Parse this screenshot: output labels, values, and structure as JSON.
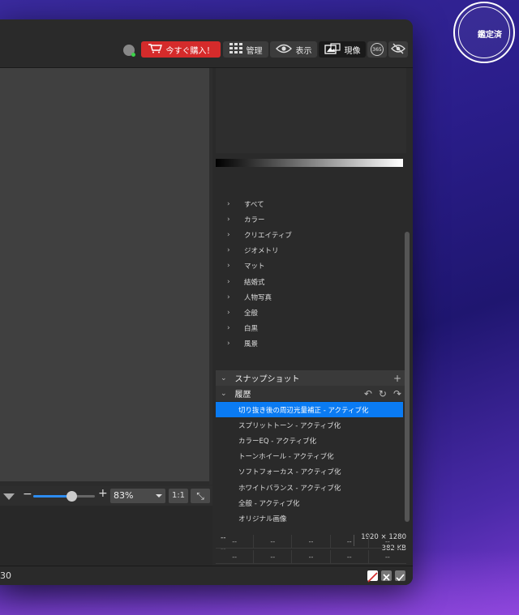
{
  "toolbar": {
    "buy_label": "今すぐ購入！",
    "manage_label": "管理",
    "view_label": "表示",
    "develop_label": "現像",
    "badge_365": "365",
    "colors": {
      "buy": "#d52b2b",
      "active": "#1a1a1a",
      "accent": "#0a7bf3"
    }
  },
  "canvas": {
    "zoom_value": "83%",
    "zoom_level": 0.62,
    "one_to_one_label": "1:1"
  },
  "presets": {
    "items": [
      {
        "label": "すべて"
      },
      {
        "label": "カラー"
      },
      {
        "label": "クリエイティブ"
      },
      {
        "label": "ジオメトリ"
      },
      {
        "label": "マット"
      },
      {
        "label": "結婚式"
      },
      {
        "label": "人物写真"
      },
      {
        "label": "全般"
      },
      {
        "label": "白黒"
      },
      {
        "label": "風景"
      }
    ]
  },
  "snapshots": {
    "title": "スナップショット"
  },
  "history": {
    "title": "履歴",
    "items": [
      {
        "label": "切り抜き後の周辺光量補正 - アクティブ化"
      },
      {
        "label": "スプリットトーン - アクティブ化"
      },
      {
        "label": "カラーEQ - アクティブ化"
      },
      {
        "label": "トーンホイール - アクティブ化"
      },
      {
        "label": "ソフトフォーカス - アクティブ化"
      },
      {
        "label": "ホワイトバランス - アクティブ化"
      },
      {
        "label": "全般 - アクティブ化"
      },
      {
        "label": "オリジナル画像"
      }
    ]
  },
  "info": {
    "dash1": "--",
    "dash2": "--",
    "resolution": "1920 × 1280",
    "filesize": "382 KB",
    "grid_rows": [
      [
        "--",
        "--",
        "--",
        "--",
        "--"
      ],
      [
        "--",
        "--",
        "--",
        "--",
        "--"
      ]
    ]
  },
  "status": {
    "number": "30"
  },
  "badge": {
    "label": "鑑定済"
  }
}
